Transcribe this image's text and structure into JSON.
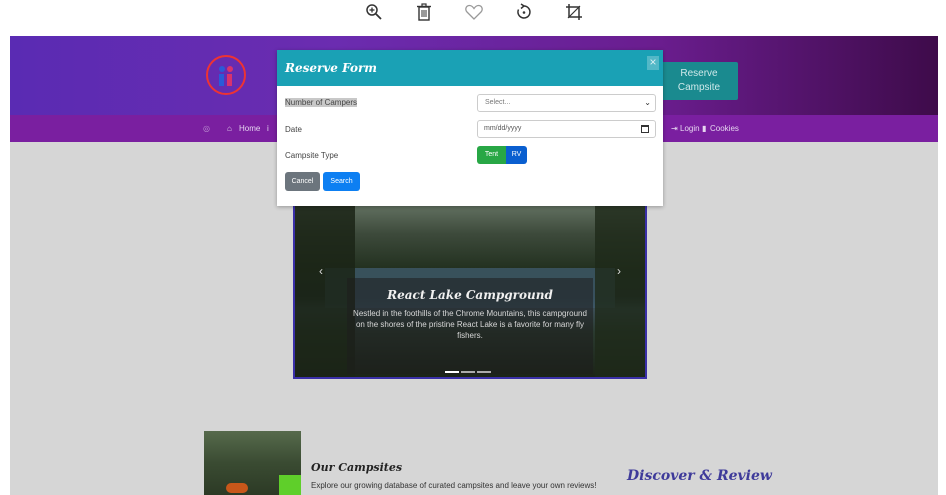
{
  "toolbar": {
    "icons": [
      "zoom-in-icon",
      "trash-icon",
      "heart-icon",
      "rotate-icon",
      "crop-icon"
    ]
  },
  "header": {
    "reserve_button": "Reserve Campsite"
  },
  "navbar": {
    "home": "Home",
    "login": "Login",
    "cookies": "Cookies"
  },
  "carousel": {
    "title": "React Lake Campground",
    "text": "Nestled in the foothills of the Chrome Mountains, this campground on the shores of the pristine React Lake is a favorite for many fly fishers.",
    "prev": "‹",
    "next": "›"
  },
  "section": {
    "our_title": "Our Campsites",
    "our_text": "Explore our growing database of curated campsites and leave your own reviews!",
    "discover": "Discover & Review"
  },
  "modal": {
    "title": "Reserve Form",
    "close": "×",
    "campers_label": "Number of Campers",
    "campers_placeholder": "Select...",
    "date_label": "Date",
    "date_placeholder": "mm/dd/yyyy",
    "type_label": "Campsite Type",
    "tent": "Tent",
    "rv": "RV",
    "cancel": "Cancel",
    "search": "Search"
  },
  "colors": {
    "modal_header": "#1aa1b5",
    "navbar": "#7a1fa0",
    "tent_button": "#28a745",
    "rv_button": "#0a5fd0",
    "search_button": "#0d7ff2",
    "cancel_button": "#6c757d"
  }
}
